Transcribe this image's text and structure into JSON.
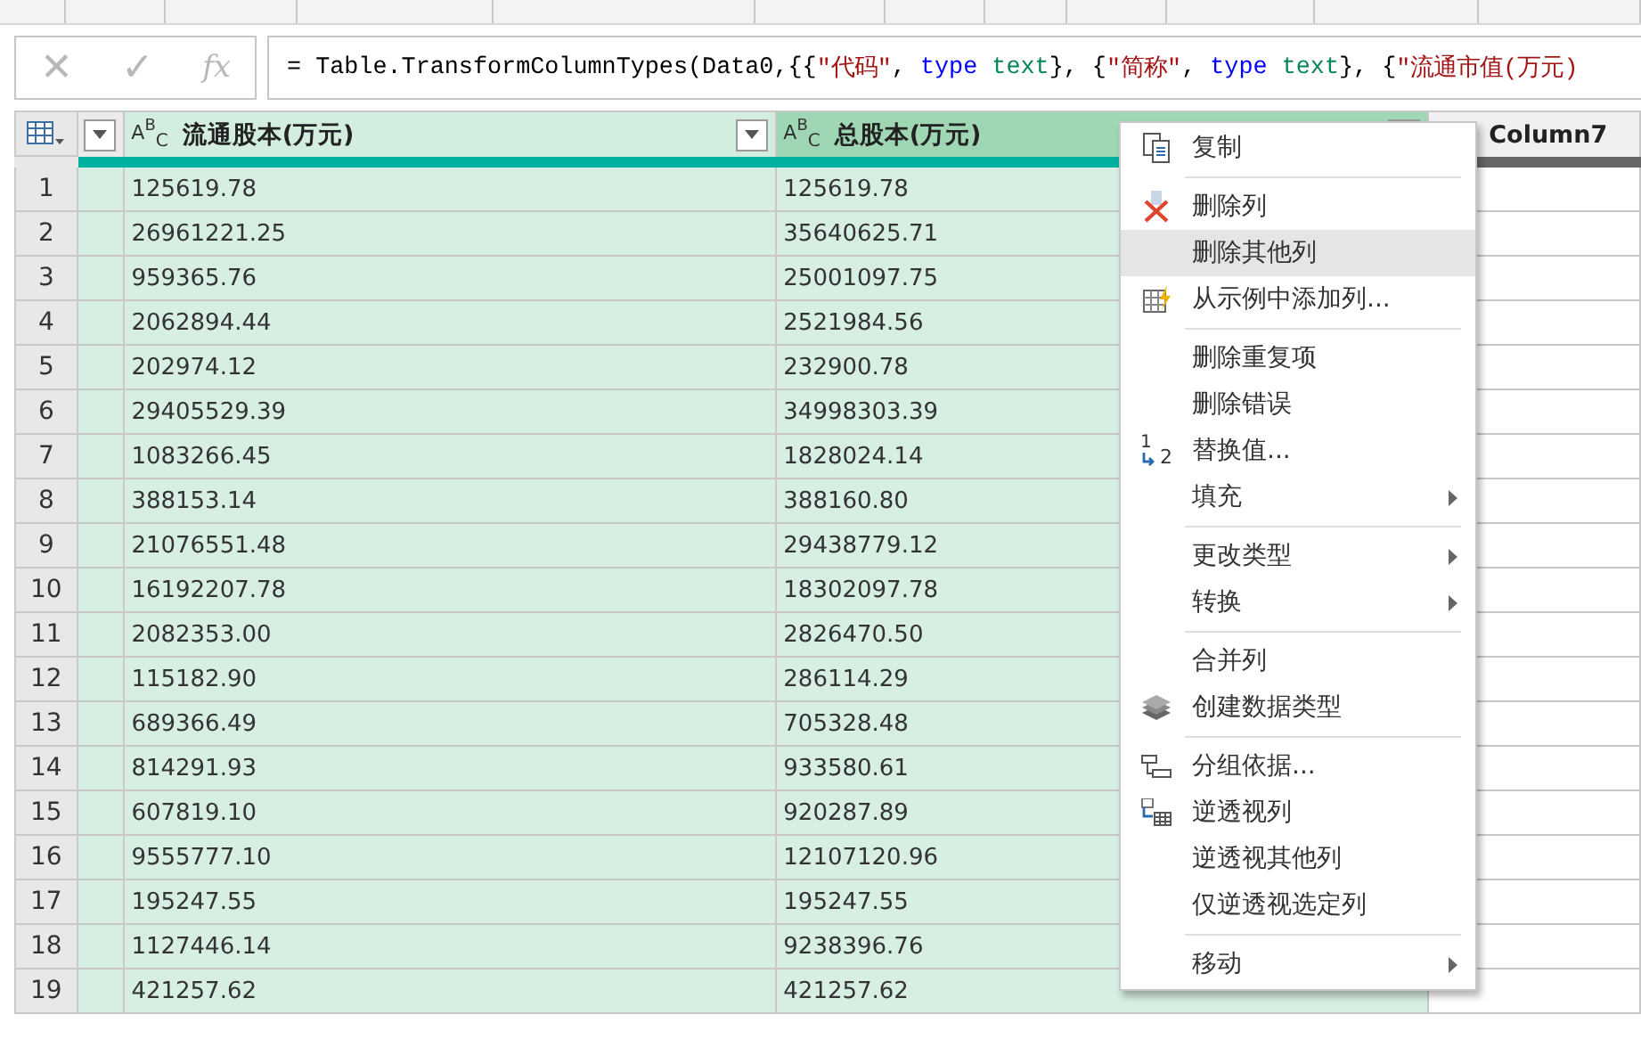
{
  "formula_bar": {
    "cancel": "✕",
    "confirm": "✓",
    "fx": "fx",
    "tokens": [
      {
        "kind": "plain",
        "text": "= Table.TransformColumnTypes(Data0,{{"
      },
      {
        "kind": "string",
        "text": "\"代码\""
      },
      {
        "kind": "plain",
        "text": ", "
      },
      {
        "kind": "keyword",
        "text": "type"
      },
      {
        "kind": "type",
        "text": " text"
      },
      {
        "kind": "plain",
        "text": "}, {"
      },
      {
        "kind": "string",
        "text": "\"简称\""
      },
      {
        "kind": "plain",
        "text": ", "
      },
      {
        "kind": "keyword",
        "text": "type"
      },
      {
        "kind": "type",
        "text": " text"
      },
      {
        "kind": "plain",
        "text": "}, {"
      },
      {
        "kind": "string",
        "text": "\"流通市值(万元)"
      }
    ]
  },
  "columns": [
    {
      "type": "A$^{B}$$_{C}$",
      "title": "流通股本(万元)",
      "selected": true,
      "active": false
    },
    {
      "type": "A$^{B}$$_{C}$",
      "title": "总股本(万元)",
      "selected": true,
      "active": true
    },
    {
      "title": "Column7",
      "selected": false,
      "active": false
    }
  ],
  "rows": [
    {
      "n": "1",
      "values": [
        "125619.78",
        "125619.78"
      ]
    },
    {
      "n": "2",
      "values": [
        "26961221.25",
        "35640625.71"
      ]
    },
    {
      "n": "3",
      "values": [
        "959365.76",
        "25001097.75"
      ]
    },
    {
      "n": "4",
      "values": [
        "2062894.44",
        "2521984.56"
      ]
    },
    {
      "n": "5",
      "values": [
        "202974.12",
        "232900.78"
      ]
    },
    {
      "n": "6",
      "values": [
        "29405529.39",
        "34998303.39"
      ]
    },
    {
      "n": "7",
      "values": [
        "1083266.45",
        "1828024.14"
      ]
    },
    {
      "n": "8",
      "values": [
        "388153.14",
        "388160.80"
      ]
    },
    {
      "n": "9",
      "values": [
        "21076551.48",
        "29438779.12"
      ]
    },
    {
      "n": "10",
      "values": [
        "16192207.78",
        "18302097.78"
      ]
    },
    {
      "n": "11",
      "values": [
        "2082353.00",
        "2826470.50"
      ]
    },
    {
      "n": "12",
      "values": [
        "115182.90",
        "286114.29"
      ]
    },
    {
      "n": "13",
      "values": [
        "689366.49",
        "705328.48"
      ]
    },
    {
      "n": "14",
      "values": [
        "814291.93",
        "933580.61"
      ]
    },
    {
      "n": "15",
      "values": [
        "607819.10",
        "920287.89"
      ]
    },
    {
      "n": "16",
      "values": [
        "9555777.10",
        "12107120.96"
      ]
    },
    {
      "n": "17",
      "values": [
        "195247.55",
        "195247.55"
      ]
    },
    {
      "n": "18",
      "values": [
        "1127446.14",
        "9238396.76"
      ]
    },
    {
      "n": "19",
      "values": [
        "421257.62",
        "421257.62"
      ]
    }
  ],
  "context_menu": {
    "groups": [
      [
        {
          "label": "复制",
          "selected": false,
          "submenu": false
        }
      ],
      [
        {
          "label": "删除列",
          "selected": false,
          "submenu": false
        },
        {
          "label": "删除其他列",
          "selected": true,
          "submenu": false
        },
        {
          "label": "从示例中添加列...",
          "selected": false,
          "submenu": false
        }
      ],
      [
        {
          "label": "删除重复项",
          "selected": false,
          "submenu": false
        },
        {
          "label": "删除错误",
          "selected": false,
          "submenu": false
        },
        {
          "label": "替换值...",
          "selected": false,
          "submenu": false,
          "icon_digits": [
            "1",
            "2"
          ]
        },
        {
          "label": "填充",
          "selected": false,
          "submenu": true
        }
      ],
      [
        {
          "label": "更改类型",
          "selected": false,
          "submenu": true
        },
        {
          "label": "转换",
          "selected": false,
          "submenu": true
        }
      ],
      [
        {
          "label": "合并列",
          "selected": false,
          "submenu": false
        },
        {
          "label": "创建数据类型",
          "selected": false,
          "submenu": false
        }
      ],
      [
        {
          "label": "分组依据...",
          "selected": false,
          "submenu": false
        },
        {
          "label": "逆透视列",
          "selected": false,
          "submenu": false
        },
        {
          "label": "逆透视其他列",
          "selected": false,
          "submenu": false
        },
        {
          "label": "仅逆透视选定列",
          "selected": false,
          "submenu": false
        }
      ],
      [
        {
          "label": "移动",
          "selected": false,
          "submenu": true
        }
      ]
    ]
  }
}
